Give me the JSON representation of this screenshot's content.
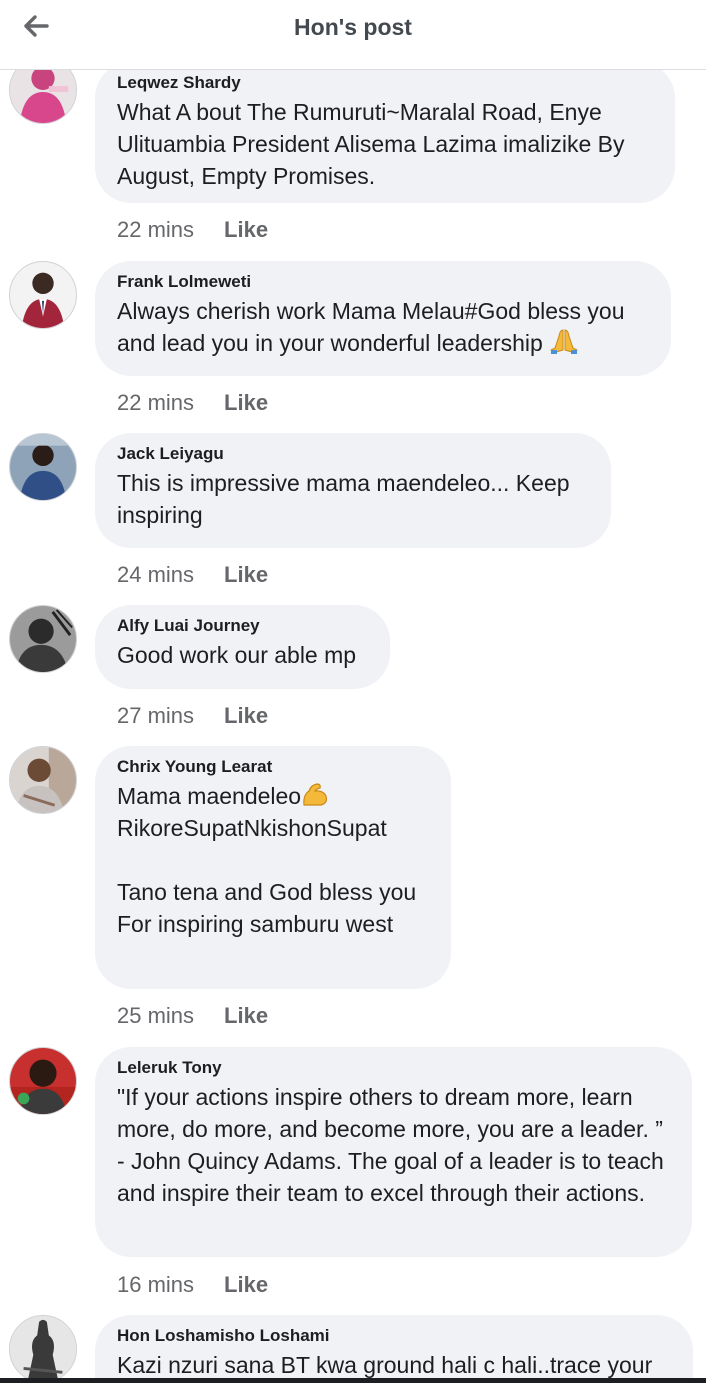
{
  "header": {
    "title": "Hon's post",
    "back_icon": "arrow-left-icon"
  },
  "colors": {
    "bubble": "#f0f2f5",
    "header_text": "#444950",
    "meta_text": "#65676b"
  },
  "comments": [
    {
      "author": "Leqwez Shardy",
      "text": "What A bout The Rumuruti~Maralal Road, Enye Ulituambia President Alisema Lazima imalizike By August, Empty Promises.",
      "time": "22 mins",
      "like": "Like"
    },
    {
      "author": "Frank Lolmeweti",
      "text": "Always cherish work Mama Melau#God bless you and lead you in your wonderful leadership",
      "time": "22 mins",
      "like": "Like"
    },
    {
      "author": "Jack Leiyagu",
      "text": "This is impressive mama maendeleo... Keep inspiring",
      "time": "24 mins",
      "like": "Like"
    },
    {
      "author": "Alfy Luai Journey",
      "text": "Good work our able mp",
      "time": "27 mins",
      "like": "Like"
    },
    {
      "author": "Chrix Young Learat",
      "text_line1": "Mama maendeleo",
      "text_rest": "\nRikoreSupatNkishonSupat\n\nTano tena and God bless you\nFor inspiring samburu west",
      "time": "25 mins",
      "like": "Like"
    },
    {
      "author": "Leleruk Tony",
      "text": "\"If your actions inspire others to dream more, learn more, do more, and become more, you are a leader. ” - John Quincy Adams. The goal of a leader is to teach and inspire their team to excel through their actions.",
      "time": "16 mins",
      "like": "Like"
    },
    {
      "author": "Hon Loshamisho Loshami",
      "text": "Kazi nzuri sana BT kwa ground hali c hali..trace your"
    }
  ]
}
